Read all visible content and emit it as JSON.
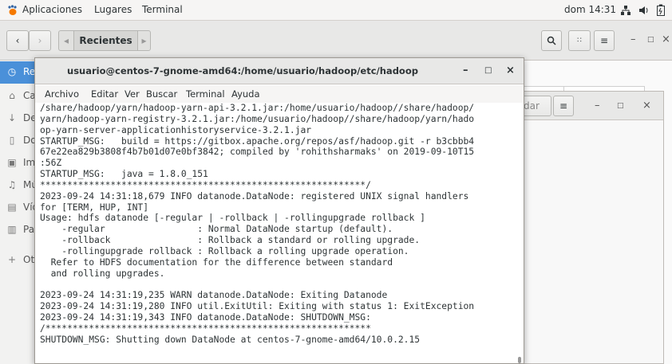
{
  "topbar": {
    "apps_label": "Aplicaciones",
    "places_label": "Lugares",
    "app_label": "Terminal",
    "clock": "dom 14:31"
  },
  "nautilus": {
    "path_current": "Recientes",
    "sidebar_items": [
      {
        "label": "Recientes",
        "icon": "clock-icon"
      },
      {
        "label": "Carpeta personal",
        "icon": "home-icon"
      },
      {
        "label": "Descargas",
        "icon": "download-icon"
      },
      {
        "label": "Documentos",
        "icon": "document-icon"
      },
      {
        "label": "Imágenes",
        "icon": "image-icon"
      },
      {
        "label": "Música",
        "icon": "music-icon"
      },
      {
        "label": "Vídeos",
        "icon": "video-icon"
      },
      {
        "label": "Papelera",
        "icon": "trash-icon"
      },
      {
        "label": "Otras ubicaciones",
        "icon": "plus-icon"
      }
    ]
  },
  "window2": {
    "search_label": "dar"
  },
  "terminal": {
    "title": "usuario@centos-7-gnome-amd64:/home/usuario/hadoop/etc/hadoop",
    "menu": [
      "Archivo",
      "Editar",
      "Ver",
      "Buscar",
      "Terminal",
      "Ayuda"
    ],
    "lines": [
      "/share/hadoop/yarn/hadoop-yarn-api-3.2.1.jar:/home/usuario/hadoop//share/hadoop/",
      "yarn/hadoop-yarn-registry-3.2.1.jar:/home/usuario/hadoop//share/hadoop/yarn/hado",
      "op-yarn-server-applicationhistoryservice-3.2.1.jar",
      "STARTUP_MSG:   build = https://gitbox.apache.org/repos/asf/hadoop.git -r b3cbbb4",
      "67e22ea829b3808f4b7b01d07e0bf3842; compiled by 'rohithsharmaks' on 2019-09-10T15",
      ":56Z",
      "STARTUP_MSG:   java = 1.8.0_151",
      "************************************************************/",
      "2023-09-24 14:31:18,679 INFO datanode.DataNode: registered UNIX signal handlers",
      "for [TERM, HUP, INT]",
      "Usage: hdfs datanode [-regular | -rollback | -rollingupgrade rollback ]",
      "    -regular                 : Normal DataNode startup (default).",
      "    -rollback                : Rollback a standard or rolling upgrade.",
      "    -rollingupgrade rollback : Rollback a rolling upgrade operation.",
      "  Refer to HDFS documentation for the difference between standard",
      "  and rolling upgrades.",
      "",
      "2023-09-24 14:31:19,235 WARN datanode.DataNode: Exiting Datanode",
      "2023-09-24 14:31:19,280 INFO util.ExitUtil: Exiting with status 1: ExitException",
      "2023-09-24 14:31:19,343 INFO datanode.DataNode: SHUTDOWN_MSG:",
      "/************************************************************",
      "SHUTDOWN_MSG: Shutting down DataNode at centos-7-gnome-amd64/10.0.2.15"
    ]
  }
}
